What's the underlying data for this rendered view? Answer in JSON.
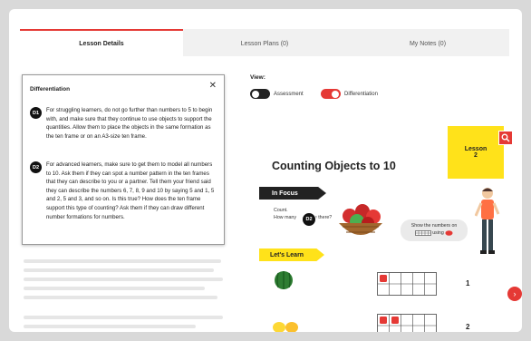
{
  "tabs": [
    {
      "label": "Lesson Details",
      "active": true
    },
    {
      "label": "Lesson Plans (0)",
      "active": false
    },
    {
      "label": "My Notes (0)",
      "active": false
    }
  ],
  "panel": {
    "title": "Differentiation",
    "close_glyph": "✕",
    "entries": [
      {
        "badge": "D1",
        "text": "For struggling learners, do not go further than numbers to 5 to begin with, and make sure that they continue to use objects to support the quantities. Allow them to place the objects in the same formation as the ten frame or on an A3-size ten frame."
      },
      {
        "badge": "D2",
        "text": "For advanced learners, make sure to get them to model all numbers to 10. Ask them if they can spot a number pattern in the ten frames that they can describe to you or a partner. Tell them your friend said they can describe the numbers 6, 7, 8, 9 and 10 by saying 5 and 1, 5 and 2, 5 and 3, and so on. Is this true? How does the ten frame support this type of counting? Ask them if they can draw different number formations for numbers."
      }
    ]
  },
  "view": {
    "label": "View:",
    "toggles": [
      {
        "label": "Assessment",
        "on": false
      },
      {
        "label": "Differentiation",
        "on": true
      }
    ]
  },
  "slide": {
    "lesson_label": "Lesson",
    "lesson_number": "2",
    "title": "Counting Objects to 10",
    "in_focus": "In Focus",
    "focus_line1": "Count.",
    "focus_line2": "How many",
    "focus_line2b": "re there?",
    "d2_badge": "D2",
    "bubble_line1": "Show the numbers on",
    "bubble_line2": "using",
    "lets_learn": "Let's Learn",
    "rows": [
      {
        "number": "1",
        "filled": 1
      },
      {
        "number": "2",
        "filled": 2
      }
    ]
  },
  "colors": {
    "accent_red": "#e53935",
    "yellow": "#ffe21a",
    "dark": "#222222"
  },
  "icons": {
    "close": "close-icon",
    "search": "magnify-icon",
    "next": "chevron-right-icon"
  }
}
